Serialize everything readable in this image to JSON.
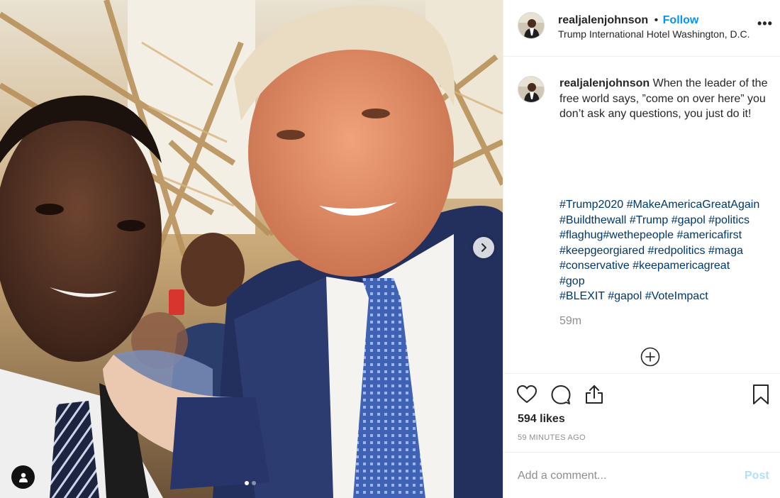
{
  "post": {
    "username": "realjalenjohnson",
    "follow_label": "Follow",
    "separator": "•",
    "location": "Trump International Hotel Washington, D.C.",
    "more_icon": "more-options-icon",
    "more_label": "•••"
  },
  "caption": {
    "username": "realjalenjohnson",
    "text": "When the leader of the free world says, ”come on over here” you don’t ask any questions, you just do it!",
    "hashtags": [
      "#Trump2020",
      "#MakeAmericaGreatAgain",
      "#Buildthewall",
      "#Trump",
      "#gapol",
      "#politics",
      "#flaghug",
      "#wethepeople",
      "#americafirst",
      "#keepgeorgiared",
      "#redpolitics",
      "#maga",
      "#conservative",
      "#keepamericagreat",
      "#gop",
      "#BLEXIT",
      "#gapol",
      "#VoteImpact"
    ],
    "time": "59m"
  },
  "hashtag_lines": [
    [
      "#Trump2020",
      " ",
      "#MakeAmericaGreatAgain"
    ],
    [
      "#Buildthewall",
      " ",
      "#Trump",
      " ",
      "#gapol",
      " ",
      "#politics"
    ],
    [
      "#flaghug",
      "",
      "#wethepeople",
      " ",
      "#americafirst"
    ],
    [
      "#keepgeorgiared",
      " ",
      "#redpolitics",
      " ",
      "#maga"
    ],
    [
      "#conservative",
      " ",
      "#keepamericagreat"
    ],
    [
      "#gop"
    ],
    [
      "#BLEXIT",
      " ",
      "#gapol",
      " ",
      "#VoteImpact"
    ]
  ],
  "engagement": {
    "likes": "594 likes",
    "time_ago": "59 MINUTES AGO"
  },
  "comment": {
    "placeholder": "Add a comment...",
    "post_label": "Post"
  },
  "carousel": {
    "total": 2,
    "current": 1
  },
  "icons": {
    "like": "heart-icon",
    "comment": "comment-icon",
    "share": "share-icon",
    "save": "bookmark-icon",
    "next": "chevron-right-icon",
    "tags": "user-tag-icon",
    "load_more": "plus-circle-icon"
  },
  "colors": {
    "link": "#00376b",
    "follow": "#0095f6",
    "muted": "#8e8e8e",
    "post_disabled": "#b2dffc"
  }
}
